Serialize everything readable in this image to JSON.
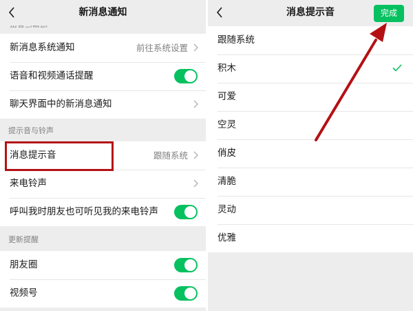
{
  "left": {
    "title": "新消息通知",
    "top_section_cut": "声音与振动",
    "rows_group1": [
      {
        "label": "新消息系统通知",
        "value": "前往系统设置"
      },
      {
        "label": "语音和视频通话提醒"
      },
      {
        "label": "聊天界面中的新消息通知"
      }
    ],
    "section_sound": "提示音与铃声",
    "rows_group2": [
      {
        "label": "消息提示音",
        "value": "跟随系统"
      },
      {
        "label": "来电铃声"
      },
      {
        "label": "呼叫我时朋友也可听见我的来电铃声"
      }
    ],
    "section_update": "更新提醒",
    "rows_group3": [
      {
        "label": "朋友圈"
      },
      {
        "label": "视频号"
      }
    ],
    "toggles": {
      "call_reminder": true,
      "friends_hear_ringtone": true,
      "moments": true,
      "channels": true
    }
  },
  "right": {
    "title": "消息提示音",
    "done_label": "完成",
    "options": [
      "跟随系统",
      "积木",
      "可爱",
      "空灵",
      "俏皮",
      "清脆",
      "灵动",
      "优雅"
    ],
    "selected": "积木"
  },
  "colors": {
    "accent": "#07c160",
    "annotation": "#b41014",
    "background": "#ededed"
  }
}
